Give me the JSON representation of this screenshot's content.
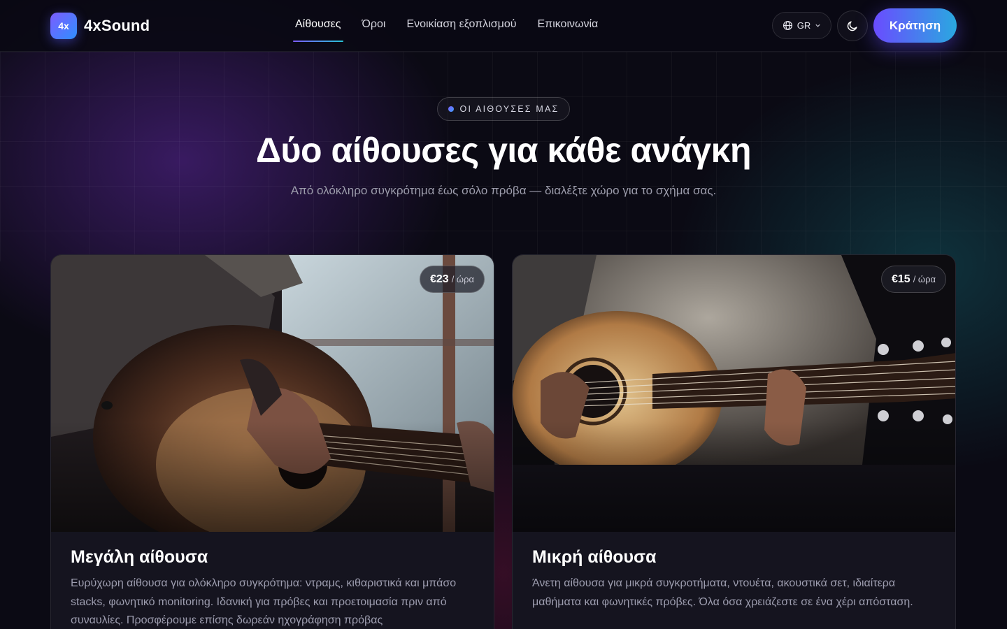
{
  "header": {
    "logo_mark": "4x",
    "brand": "4xSound",
    "nav": [
      {
        "label": "Αίθουσες",
        "active": true
      },
      {
        "label": "Όροι",
        "active": false
      },
      {
        "label": "Ενοικίαση εξοπλισμού",
        "active": false
      },
      {
        "label": "Επικοινωνία",
        "active": false
      }
    ],
    "language": "GR",
    "language_icon": "globe-icon",
    "theme_icon": "moon-icon",
    "book_label": "Κράτηση"
  },
  "hero": {
    "eyebrow": "ΟΙ ΑΙΘΟΥΣΕΣ ΜΑΣ",
    "title": "Δύο αίθουσες για κάθε ανάγκη",
    "subtitle": "Από ολόκληρο συγκρότημα έως σόλο πρόβα — διαλέξτε χώρο για το σχήμα σας."
  },
  "rooms": [
    {
      "price": "€23",
      "price_unit": "/ ώρα",
      "title": "Μεγάλη αίθουσα",
      "description": "Ευρύχωρη αίθουσα για ολόκληρο συγκρότημα: ντραμς, κιθαριστικά και μπάσο stacks, φωνητικό monitoring. Ιδανική για πρόβες και προετοιμασία πριν από συναυλίες. Προσφέρουμε επίσης δωρεάν ηχογράφηση πρόβας"
    },
    {
      "price": "€15",
      "price_unit": "/ ώρα",
      "title": "Μικρή αίθουσα",
      "description": "Άνετη αίθουσα για μικρά συγκροτήματα, ντουέτα, ακουστικά σετ, ιδιαίτερα μαθήματα και φωνητικές πρόβες. Όλα όσα χρειάζεστε σε ένα χέρι απόσταση."
    }
  ],
  "colors": {
    "accent_start": "#6a4cff",
    "accent_end": "#2aa8e0",
    "background": "#0b0a14"
  }
}
